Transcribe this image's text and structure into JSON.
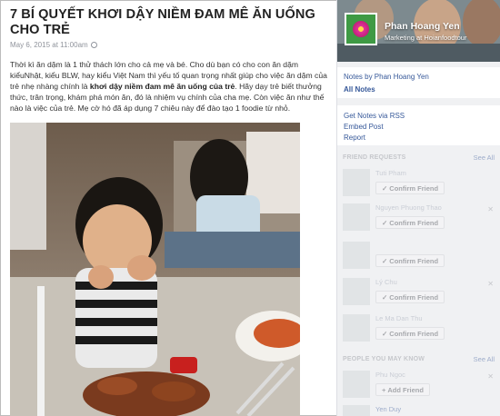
{
  "note": {
    "title": "7 BÍ QUYẾT KHƠI DẬY NIỀM ĐAM MÊ ĂN UỐNG CHO TRẺ",
    "date": "May 6, 2015 at 11:00am",
    "body_part1": "Thời kì ăn dặm là 1 thử thách lớn cho cả mẹ và bé. Cho dù bạn có cho con ăn dặm kiểuNhật, kiểu BLW, hay kiểu Việt Nam thì yếu tố quan trọng nhất giúp cho việc ăn dặm của trẻ nhẹ nhàng chính là ",
    "body_bold": "khơi dậy niềm đam mê ăn uống của trẻ",
    "body_part2": ". Hãy dạy trẻ biết thưởng thức, trân trọng, khám phá món ăn, đó là nhiệm vụ chính của cha mẹ. Còn việc ăn như thế nào là việc của trẻ. Mẹ cờ hó đã áp dụng 7 chiêu này để đào tạo 1 foodie từ nhỏ."
  },
  "profile": {
    "name": "Phan Hoang Yen",
    "subtitle": "Marketing at Hoianfoodtour"
  },
  "sidebar": {
    "notes_by": "Notes by Phan Hoang Yen",
    "all_notes": "All Notes",
    "rss": "Get Notes via RSS",
    "embed": "Embed Post",
    "report": "Report"
  },
  "friend_requests": {
    "header": "FRIEND REQUESTS",
    "see_all": "See All",
    "items": [
      {
        "name": "Tuti Pham",
        "button": "Confirm Friend"
      },
      {
        "name": "Nguyen Phuong Thao",
        "button": "Confirm Friend"
      },
      {
        "name": "",
        "button": "Confirm Friend"
      },
      {
        "name": "Lý Chu",
        "button": "Confirm Friend"
      },
      {
        "name": "Le Ma Dan Thu",
        "button": "Confirm Friend"
      }
    ]
  },
  "people_you_may_know": {
    "header": "PEOPLE YOU MAY KNOW",
    "see_all": "See All",
    "items": [
      {
        "name": "Phu Ngoc",
        "button": "Add Friend"
      },
      {
        "name": "Yen Duy",
        "button": ""
      }
    ]
  },
  "colors": {
    "link": "#365899",
    "sidebar_bg": "#f0f1f3",
    "profile_green": "#3f9a44"
  }
}
